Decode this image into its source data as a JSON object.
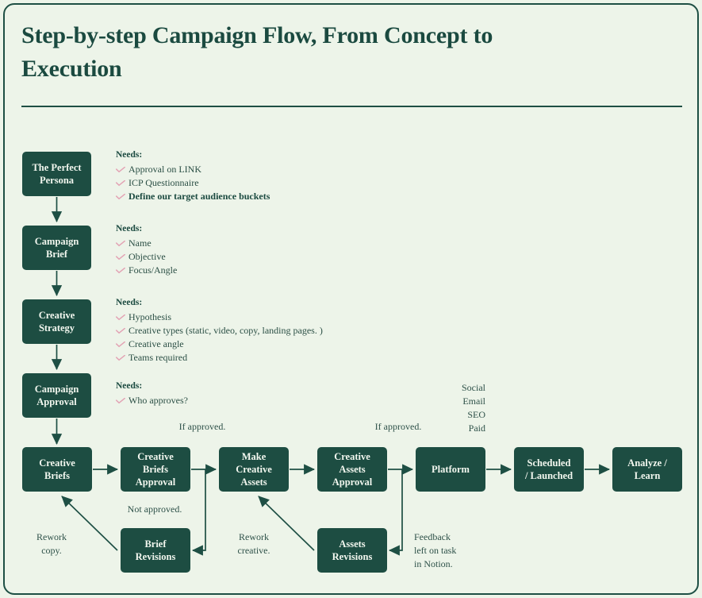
{
  "title": "Step-by-step Campaign Flow,\nFrom Concept to Execution",
  "colors": {
    "background": "#edf4e9",
    "node": "#1d4d42",
    "node_text": "#f2f7ef",
    "accent_line": "#1e4f44",
    "check": "#e3a3b4",
    "body_text": "#2e5149"
  },
  "stages": [
    {
      "id": "persona",
      "label": "The Perfect\nPersona"
    },
    {
      "id": "brief",
      "label": "Campaign\nBrief"
    },
    {
      "id": "strategy",
      "label": "Creative\nStrategy"
    },
    {
      "id": "approval",
      "label": "Campaign\nApproval"
    }
  ],
  "needs_label": "Needs:",
  "needs": [
    {
      "for": "persona",
      "title": "Needs:",
      "items": [
        {
          "text": "Approval on  LINK",
          "bold": false
        },
        {
          "text": "ICP Questionnaire",
          "bold": false
        },
        {
          "text": "Define our target audience buckets",
          "bold": true
        }
      ]
    },
    {
      "for": "brief",
      "title": "Needs:",
      "items": [
        {
          "text": "Name",
          "bold": false
        },
        {
          "text": "Objective",
          "bold": false
        },
        {
          "text": "Focus/Angle",
          "bold": false
        }
      ]
    },
    {
      "for": "strategy",
      "title": "Needs:",
      "items": [
        {
          "text": "Hypothesis",
          "bold": false
        },
        {
          "text": "Creative types (static, video, copy, landing pages. )",
          "bold": false
        },
        {
          "text": "Creative angle",
          "bold": false
        },
        {
          "text": "Teams required",
          "bold": false
        }
      ]
    },
    {
      "for": "approval",
      "title": "Needs:",
      "items": [
        {
          "text": "Who approves?",
          "bold": false
        }
      ]
    }
  ],
  "flow_row": [
    {
      "id": "creative-briefs",
      "label": "Creative\nBriefs"
    },
    {
      "id": "creative-briefs-approval",
      "label": "Creative\nBriefs\nApproval"
    },
    {
      "id": "make-creative-assets",
      "label": "Make\nCreative\nAssets"
    },
    {
      "id": "creative-assets-approval",
      "label": "Creative\nAssets\nApproval"
    },
    {
      "id": "platform",
      "label": "Platform"
    },
    {
      "id": "scheduled-launched",
      "label": "Scheduled\n/ Launched"
    },
    {
      "id": "analyze-learn",
      "label": "Analyze /\nLearn"
    }
  ],
  "revision_row": [
    {
      "id": "brief-revisions",
      "label": "Brief\nRevisions"
    },
    {
      "id": "assets-revisions",
      "label": "Assets\nRevisions"
    }
  ],
  "edge_labels": {
    "if_approved_1": "If approved.",
    "if_approved_2": "If approved.",
    "not_approved": "Not approved.",
    "rework_copy": "Rework\ncopy.",
    "rework_creative": "Rework\ncreative.",
    "feedback": "Feedback\nleft on task\nin Notion."
  },
  "platform_channels": "Social\nEmail\nSEO\nPaid"
}
